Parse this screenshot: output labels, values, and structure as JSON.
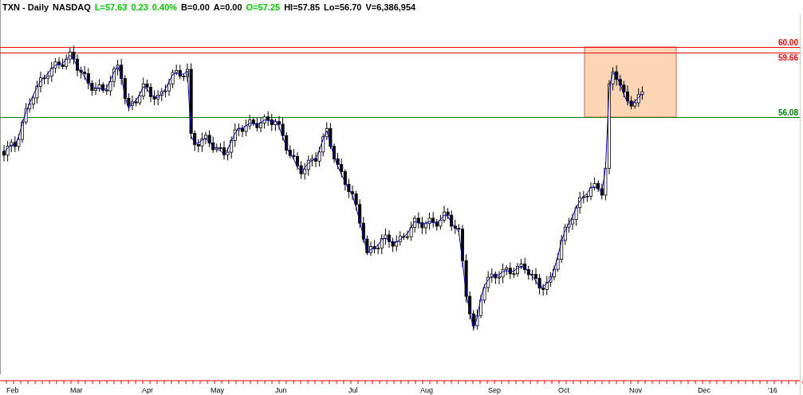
{
  "header": [
    {
      "text": "TXN - Daily",
      "color": "#000000"
    },
    {
      "text": "NASDAQ",
      "color": "#000000"
    },
    {
      "text": "L=57.63",
      "color": "#00cc00"
    },
    {
      "text": "0.23",
      "color": "#00cc00"
    },
    {
      "text": "0.40%",
      "color": "#00cc00"
    },
    {
      "text": "B=0.00",
      "color": "#000000"
    },
    {
      "text": "A=0.00",
      "color": "#000000"
    },
    {
      "text": "O=57.25",
      "color": "#00cc00"
    },
    {
      "text": "HI=57.85",
      "color": "#000000"
    },
    {
      "text": "Lo=56.70",
      "color": "#000000"
    },
    {
      "text": "V=6,386,954",
      "color": "#000000"
    }
  ],
  "levels": [
    {
      "label": "60.00",
      "color": "#ff0000"
    },
    {
      "label": "59.66",
      "color": "#ff0000"
    },
    {
      "label": "56.08",
      "color": "#008000"
    }
  ],
  "months": [
    "Feb",
    "Mar",
    "Apr",
    "May",
    "Jun",
    "Jul",
    "Aug",
    "Sep",
    "Oct",
    "Nov",
    "Dec",
    "'16"
  ]
}
